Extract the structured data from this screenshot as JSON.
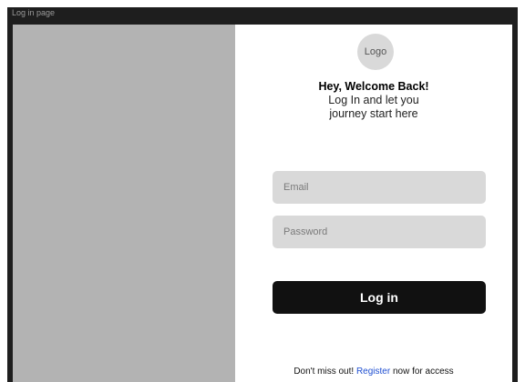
{
  "window": {
    "title": "Log in page"
  },
  "logo": {
    "label": "Logo"
  },
  "welcome": {
    "heading": "Hey, Welcome Back!",
    "subheading": "Log In and let you journey start here"
  },
  "form": {
    "email_placeholder": "Email",
    "password_placeholder": "Password",
    "login_label": "Log in"
  },
  "footer": {
    "prefix": "Don't miss out! ",
    "link": "Register",
    "suffix": " now for access"
  },
  "colors": {
    "image_placeholder": "#b3b3b3",
    "field_bg": "#d9d9d9",
    "button_bg": "#111111",
    "link": "#1f4fd1"
  }
}
